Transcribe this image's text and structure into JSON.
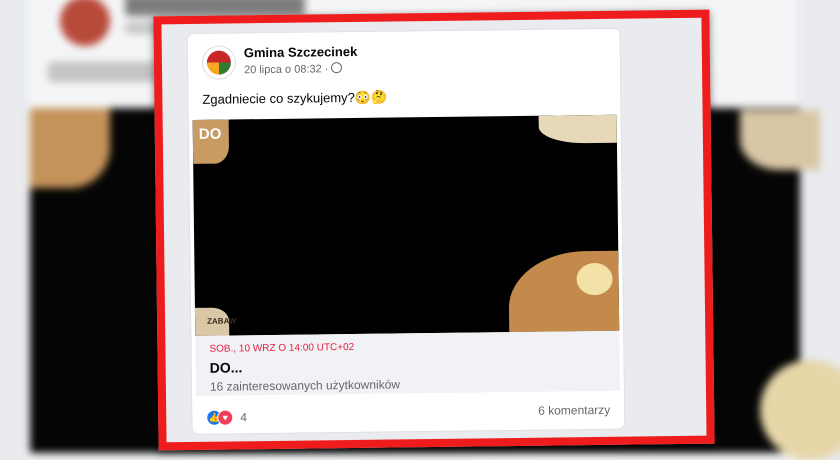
{
  "post": {
    "author": "Gmina Szczecinek",
    "timestamp": "20 lipca o 08:32 ·",
    "text": "Zgadniecie co szykujemy?😳🤔",
    "media_text_top": "DO",
    "media_text_bottom": "ZABAW"
  },
  "event": {
    "date": "SOB., 10 WRZ O 14:00 UTC+02",
    "title": "DO...",
    "interested": "16 zainteresowanych użytkowników"
  },
  "footer": {
    "reaction_count": "4",
    "comments": "6 komentarzy"
  },
  "colors": {
    "frame": "#ee1c1c",
    "event_date": "#e41e3f",
    "like": "#1877f2",
    "love": "#f33e58"
  }
}
